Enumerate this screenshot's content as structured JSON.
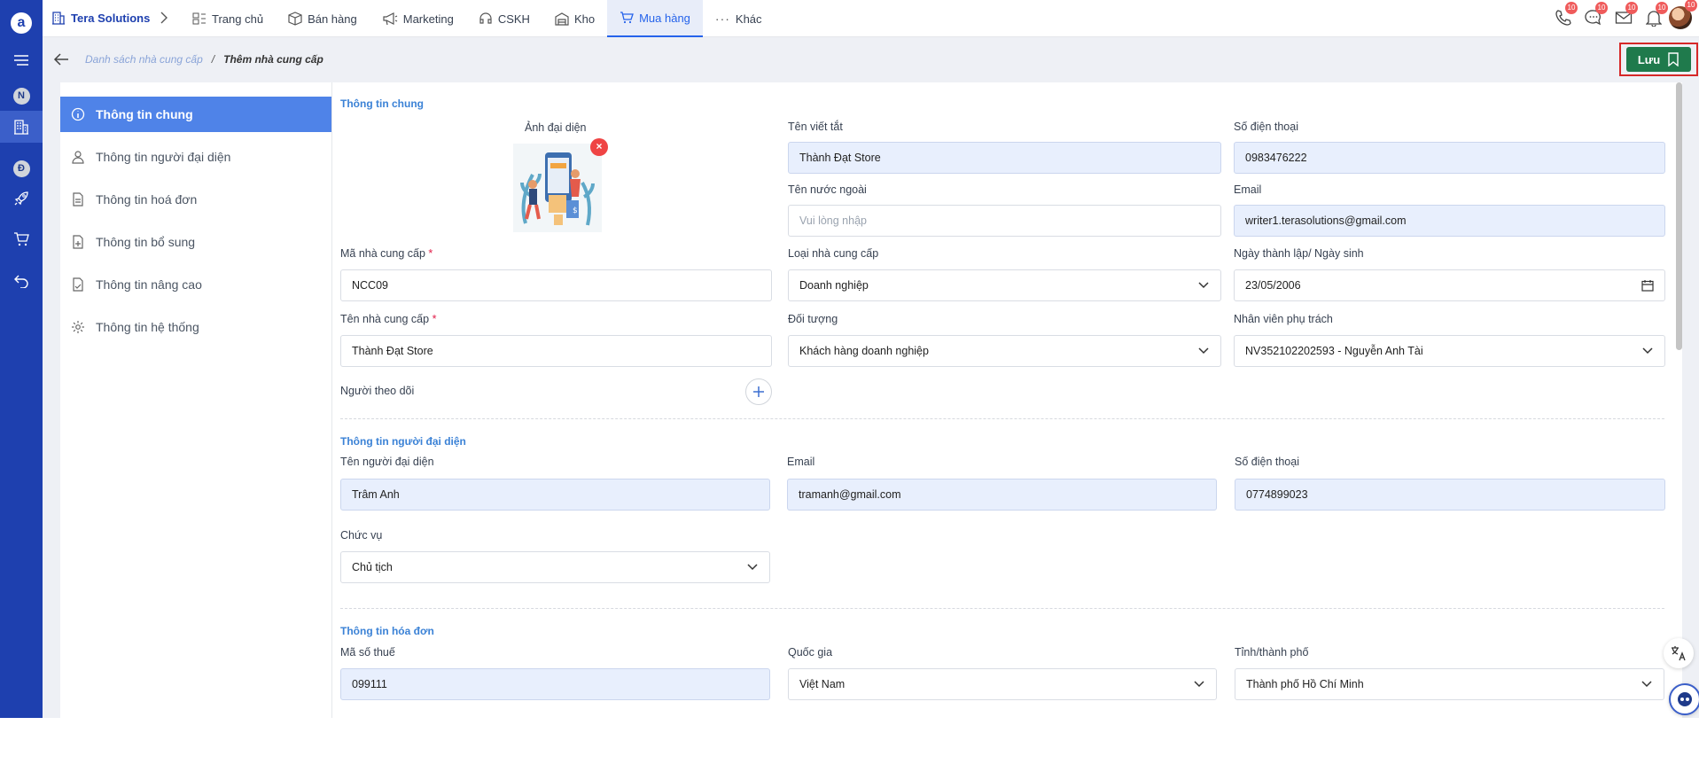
{
  "brand": {
    "name": "Tera Solutions"
  },
  "rail": {
    "badges": [
      "N",
      "Đ"
    ]
  },
  "nav": [
    {
      "label": "Trang chủ",
      "icon": "home-icon"
    },
    {
      "label": "Bán hàng",
      "icon": "box-icon"
    },
    {
      "label": "Marketing",
      "icon": "megaphone-icon"
    },
    {
      "label": "CSKH",
      "icon": "headset-icon"
    },
    {
      "label": "Kho",
      "icon": "warehouse-icon"
    },
    {
      "label": "Mua hàng",
      "icon": "cart-icon",
      "active": true
    },
    {
      "label": "Khác",
      "icon": "more-icon"
    }
  ],
  "notifications": {
    "phone": "10",
    "chat": "10",
    "mail": "10",
    "bell": "10",
    "avatar": "10"
  },
  "breadcrumb": {
    "parent": "Danh sách nhà cung cấp",
    "separator": "/",
    "current": "Thêm nhà cung cấp"
  },
  "save": {
    "label": "Lưu"
  },
  "tabs": [
    {
      "label": "Thông tin chung",
      "icon": "info-icon",
      "active": true
    },
    {
      "label": "Thông tin người đại diện",
      "icon": "user-icon"
    },
    {
      "label": "Thông tin hoá đơn",
      "icon": "invoice-icon"
    },
    {
      "label": "Thông tin bổ sung",
      "icon": "file-plus-icon"
    },
    {
      "label": "Thông tin nâng cao",
      "icon": "file-check-icon"
    },
    {
      "label": "Thông tin hệ thống",
      "icon": "gear-icon"
    }
  ],
  "general": {
    "title": "Thông tin chung",
    "avatar_label": "Ảnh đại diện",
    "short_name": {
      "label": "Tên viết tắt",
      "value": "Thành Đạt Store"
    },
    "phone": {
      "label": "Số điện thoại",
      "value": "0983476222"
    },
    "foreign_name": {
      "label": "Tên nước ngoài",
      "placeholder": "Vui lòng nhập"
    },
    "email": {
      "label": "Email",
      "value": "writer1.terasolutions@gmail.com"
    },
    "code": {
      "label": "Mã nhà cung cấp",
      "required": "*",
      "value": "NCC09"
    },
    "supplier_type": {
      "label": "Loại nhà cung cấp",
      "value": "Doanh nghiệp"
    },
    "founded": {
      "label": "Ngày thành lập/ Ngày sinh",
      "value": "23/05/2006"
    },
    "name": {
      "label": "Tên nhà cung cấp",
      "required": "*",
      "value": "Thành Đạt Store"
    },
    "target": {
      "label": "Đối tượng",
      "value": "Khách hàng doanh nghiệp"
    },
    "staff": {
      "label": "Nhân viên phụ trách",
      "value": "NV352102202593 - Nguyễn Anh Tài"
    },
    "followers": {
      "label": "Người theo dõi"
    }
  },
  "representative": {
    "title": "Thông tin người đại diện",
    "name": {
      "label": "Tên người đại diện",
      "value": "Trâm Anh"
    },
    "email": {
      "label": "Email",
      "value": "tramanh@gmail.com"
    },
    "phone": {
      "label": "Số điện thoại",
      "value": "0774899023"
    },
    "position": {
      "label": "Chức vụ",
      "value": "Chủ tịch"
    }
  },
  "invoice": {
    "title": "Thông tin hóa đơn",
    "tax_code": {
      "label": "Mã số thuế",
      "value": "099111"
    },
    "country": {
      "label": "Quốc gia",
      "value": "Việt Nam"
    },
    "province": {
      "label": "Tỉnh/thành phố",
      "value": "Thành phố Hồ Chí Minh"
    }
  },
  "colors": {
    "rail": "#1e40af",
    "accent": "#4f83e8",
    "save": "#1f7a4c",
    "highlight": "#d62828",
    "filled": "#e8effd"
  }
}
